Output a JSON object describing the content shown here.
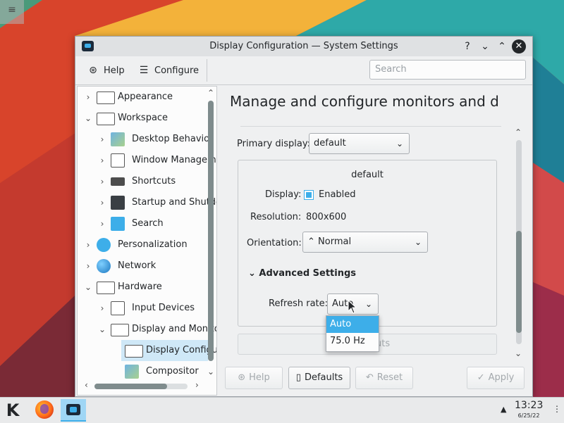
{
  "desktop": {
    "menu_icon": "hamburger-icon"
  },
  "window": {
    "title": "Display Configuration  — System Settings",
    "controls": {
      "help": "?",
      "minimize": "⌄",
      "maximize": "⌃",
      "close": "✕"
    }
  },
  "toolbar": {
    "help_label": "Help",
    "configure_label": "Configure",
    "search_placeholder": "Search"
  },
  "sidebar": {
    "items": [
      {
        "label": "Appearance",
        "icon": "appearance-icon"
      },
      {
        "label": "Workspace",
        "icon": "workspace-icon"
      },
      {
        "label": "Desktop Behavior",
        "icon": "desktop-behavior-icon"
      },
      {
        "label": "Window Management",
        "icon": "window-management-icon"
      },
      {
        "label": "Shortcuts",
        "icon": "keyboard-icon"
      },
      {
        "label": "Startup and Shutdown",
        "icon": "startup-icon"
      },
      {
        "label": "Search",
        "icon": "search-icon"
      },
      {
        "label": "Personalization",
        "icon": "personalization-icon"
      },
      {
        "label": "Network",
        "icon": "globe-icon"
      },
      {
        "label": "Hardware",
        "icon": "hardware-icon"
      },
      {
        "label": "Input Devices",
        "icon": "input-devices-icon"
      },
      {
        "label": "Display and Monitor",
        "icon": "monitor-icon"
      },
      {
        "label": "Display Configuration",
        "icon": "display-icon"
      },
      {
        "label": "Compositor",
        "icon": "compositor-icon"
      }
    ]
  },
  "page": {
    "title": "Manage and configure monitors and displays",
    "primary_display_label": "Primary display:",
    "primary_display_value": "default",
    "output_name": "default",
    "display_label": "Display:",
    "display_enabled_label": "Enabled",
    "resolution_label": "Resolution:",
    "resolution_value": "800x600",
    "orientation_label": "Orientation:",
    "orientation_value": "Normal",
    "advanced_label": "Advanced Settings",
    "refresh_label": "Refresh rate:",
    "refresh_value": "Auto",
    "refresh_options": [
      "Auto",
      "75.0 Hz"
    ],
    "outputs_button": "Unify Outputs",
    "outputs_button_visible": "uts"
  },
  "buttons": {
    "help": "Help",
    "defaults": "Defaults",
    "reset": "Reset",
    "apply": "Apply"
  },
  "taskbar": {
    "time": "13:23",
    "date": "6/25/22"
  },
  "colors": {
    "accent": "#3daee9",
    "window_bg": "#eff0f1",
    "text": "#232629"
  }
}
